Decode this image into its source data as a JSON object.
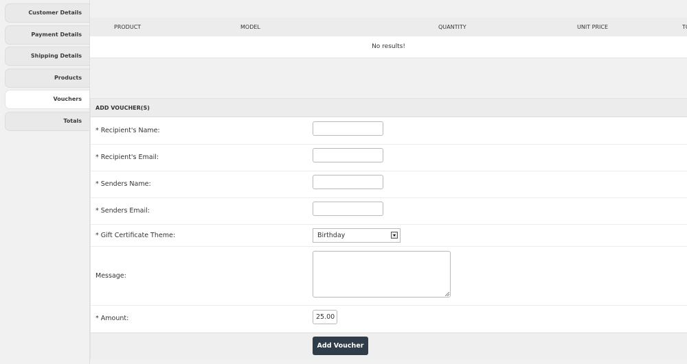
{
  "sidebar": {
    "tabs": [
      {
        "label": "Customer Details",
        "active": false
      },
      {
        "label": "Payment Details",
        "active": false
      },
      {
        "label": "Shipping Details",
        "active": false
      },
      {
        "label": "Products",
        "active": false
      },
      {
        "label": "Vouchers",
        "active": true
      },
      {
        "label": "Totals",
        "active": false
      }
    ]
  },
  "products_table": {
    "columns": [
      "PRODUCT",
      "MODEL",
      "QUANTITY",
      "UNIT PRICE",
      "TO"
    ],
    "empty_message": "No results!"
  },
  "voucher_form": {
    "heading": "ADD VOUCHER(S)",
    "fields": {
      "recipient_name": {
        "label": "* Recipient's Name:",
        "value": ""
      },
      "recipient_email": {
        "label": "* Recipient's Email:",
        "value": ""
      },
      "senders_name": {
        "label": "* Senders Name:",
        "value": ""
      },
      "senders_email": {
        "label": "* Senders Email:",
        "value": ""
      },
      "theme": {
        "label": "* Gift Certificate Theme:",
        "value": "Birthday"
      },
      "message": {
        "label": "Message:",
        "value": ""
      },
      "amount": {
        "label": "* Amount:",
        "value": "25.00"
      }
    },
    "submit_label": "Add Voucher"
  },
  "colors": {
    "background": "#f1f1f1",
    "panel": "#ffffff",
    "header_bar": "#ececec",
    "button": "#2f3d4a"
  }
}
